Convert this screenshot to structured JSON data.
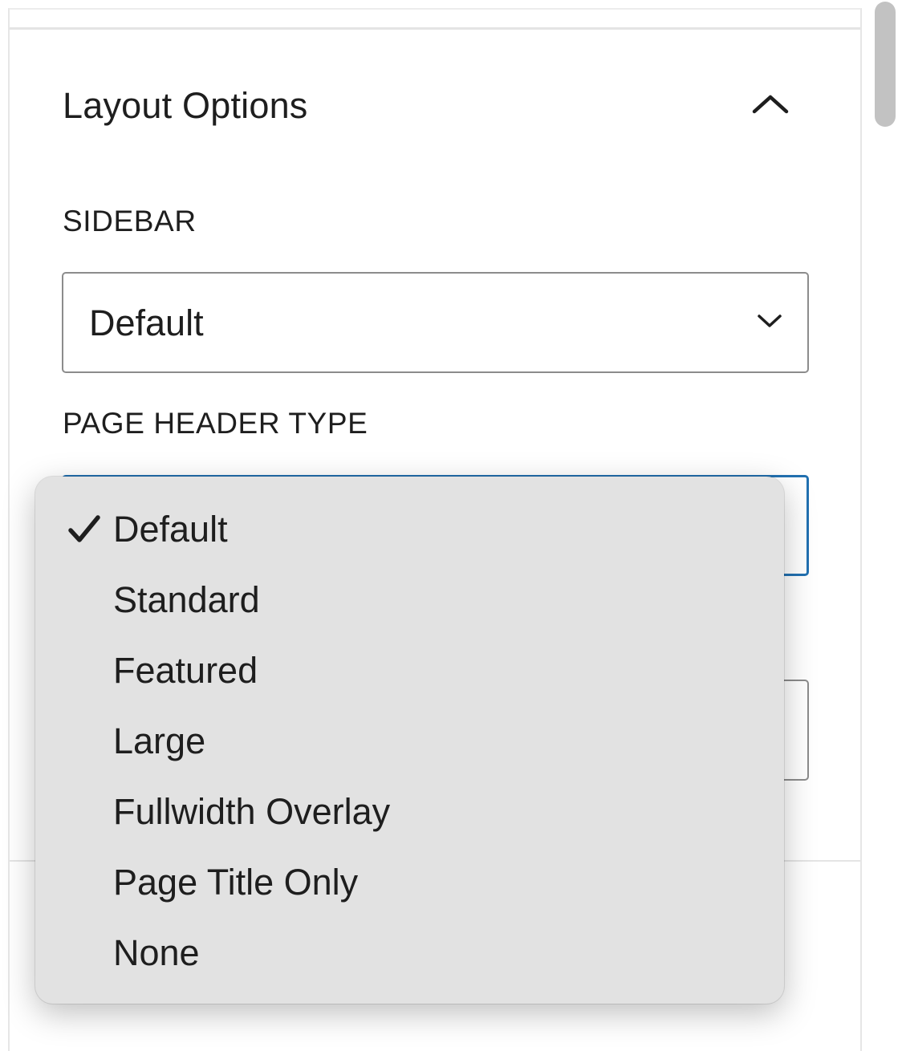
{
  "panel": {
    "section_title": "Layout Options",
    "toggle_icon": "chevron-up-icon"
  },
  "fields": {
    "sidebar": {
      "label": "SIDEBAR",
      "value": "Default"
    },
    "page_header_type": {
      "label": "PAGE HEADER TYPE",
      "value": "Default",
      "focus_color": "#2271b1"
    }
  },
  "dropdown": {
    "selected": "Default",
    "options": [
      "Default",
      "Standard",
      "Featured",
      "Large",
      "Fullwidth Overlay",
      "Page Title Only",
      "None"
    ]
  }
}
